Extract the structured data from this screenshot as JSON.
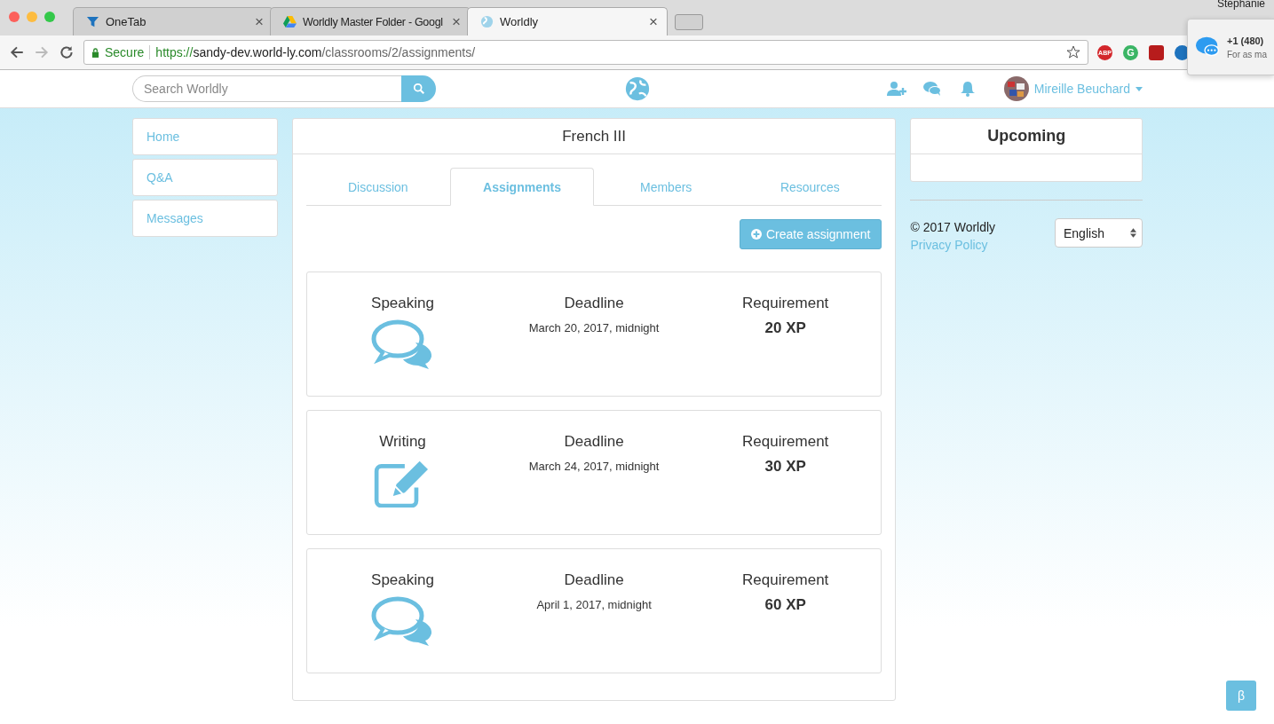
{
  "browser": {
    "tabs": [
      {
        "title": "OneTab",
        "kind": "funnel",
        "close": "×",
        "selected": false
      },
      {
        "title": "Worldly Master Folder - Googl",
        "kind": "drive",
        "close": "×",
        "selected": false
      },
      {
        "title": "Worldly",
        "kind": "globe",
        "close": "×",
        "selected": true
      }
    ],
    "profile": "Stephanie",
    "address": {
      "secure_label": "Secure",
      "scheme": "https://",
      "host": "sandy-dev.world-ly.com",
      "path": "/classrooms/2/assignments/"
    },
    "extensions": [
      {
        "label": "ABP",
        "kind": "abp"
      },
      {
        "label": "G",
        "kind": "grammarly"
      },
      {
        "kind": "mendeley"
      },
      {
        "kind": "funnel"
      }
    ]
  },
  "notification": {
    "title": "+1 (480)",
    "body": "For as ma"
  },
  "header": {
    "search": {
      "placeholder": "Search Worldly"
    },
    "user": "Mireille Beuchard"
  },
  "sidebar": {
    "items": [
      {
        "label": "Home"
      },
      {
        "label": "Q&A"
      },
      {
        "label": "Messages"
      }
    ]
  },
  "classroom": {
    "title": "French III",
    "tabs": [
      {
        "label": "Discussion",
        "selected": false
      },
      {
        "label": "Assignments",
        "selected": true
      },
      {
        "label": "Members",
        "selected": false
      },
      {
        "label": "Resources",
        "selected": false
      }
    ],
    "create_button": "Create assignment",
    "assignments": [
      {
        "kind": "speaking",
        "type": "Speaking",
        "deadline_label": "Deadline",
        "deadline": "March 20, 2017, midnight",
        "requirement_label": "Requirement",
        "requirement": "20 XP"
      },
      {
        "kind": "writing",
        "type": "Writing",
        "deadline_label": "Deadline",
        "deadline": "March 24, 2017, midnight",
        "requirement_label": "Requirement",
        "requirement": "30 XP"
      },
      {
        "kind": "speaking",
        "type": "Speaking",
        "deadline_label": "Deadline",
        "deadline": "April 1, 2017, midnight",
        "requirement_label": "Requirement",
        "requirement": "60 XP"
      }
    ]
  },
  "upcoming": {
    "title": "Upcoming"
  },
  "footer": {
    "copyright": "© 2017 Worldly",
    "privacy": "Privacy Policy",
    "language": "English"
  },
  "beta_button": "β"
}
